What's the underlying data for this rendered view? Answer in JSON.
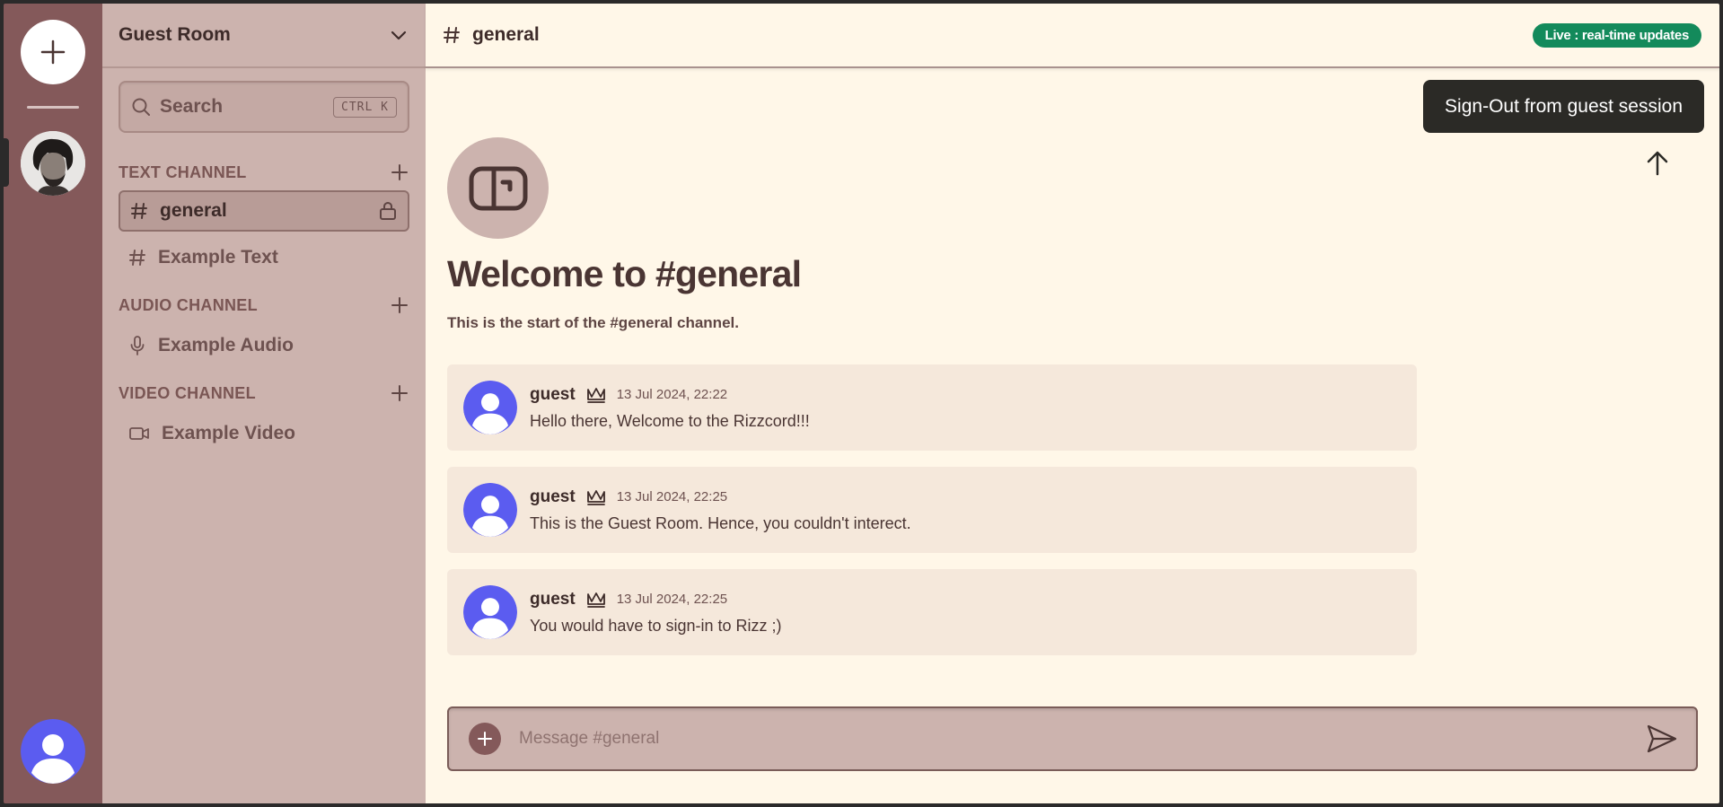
{
  "server": {
    "name": "Guest Room"
  },
  "search": {
    "label": "Search",
    "shortcut": "CTRL K"
  },
  "sections": {
    "text": {
      "title": "TEXT CHANNEL",
      "channels": [
        "general",
        "Example Text"
      ]
    },
    "audio": {
      "title": "AUDIO CHANNEL",
      "channels": [
        "Example Audio"
      ]
    },
    "video": {
      "title": "VIDEO CHANNEL",
      "channels": [
        "Example Video"
      ]
    }
  },
  "topbar": {
    "channel": "general",
    "badge": "Live : real-time updates"
  },
  "signout": {
    "label": "Sign-Out from guest session"
  },
  "welcome": {
    "title": "Welcome to #general",
    "subtitle": "This is the start of the #general channel."
  },
  "messages": [
    {
      "author": "guest",
      "time": "13 Jul 2024, 22:22",
      "text": "Hello there, Welcome to the Rizzcord!!!"
    },
    {
      "author": "guest",
      "time": "13 Jul 2024, 22:25",
      "text": "This is the Guest Room. Hence, you couldn't interect."
    },
    {
      "author": "guest",
      "time": "13 Jul 2024, 22:25",
      "text": "You would have to sign-in to Rizz ;)"
    }
  ],
  "composer": {
    "placeholder": "Message #general"
  },
  "colors": {
    "rail": "#84595a",
    "sidebar": "#ccb3ae",
    "main": "#fff7e8",
    "live_badge": "#138a5b",
    "avatar": "#5b5cf0",
    "signout": "#2b2a26"
  },
  "icons": {
    "rail_add": "plus-icon",
    "server_menu": "chevron-down-icon",
    "search": "search-icon",
    "text_channel": "hash-icon",
    "lock": "lock-icon",
    "audio_channel": "microphone-icon",
    "video_channel": "video-icon",
    "crown": "crown-icon",
    "send": "send-icon",
    "scroll_top": "arrow-up-icon"
  }
}
